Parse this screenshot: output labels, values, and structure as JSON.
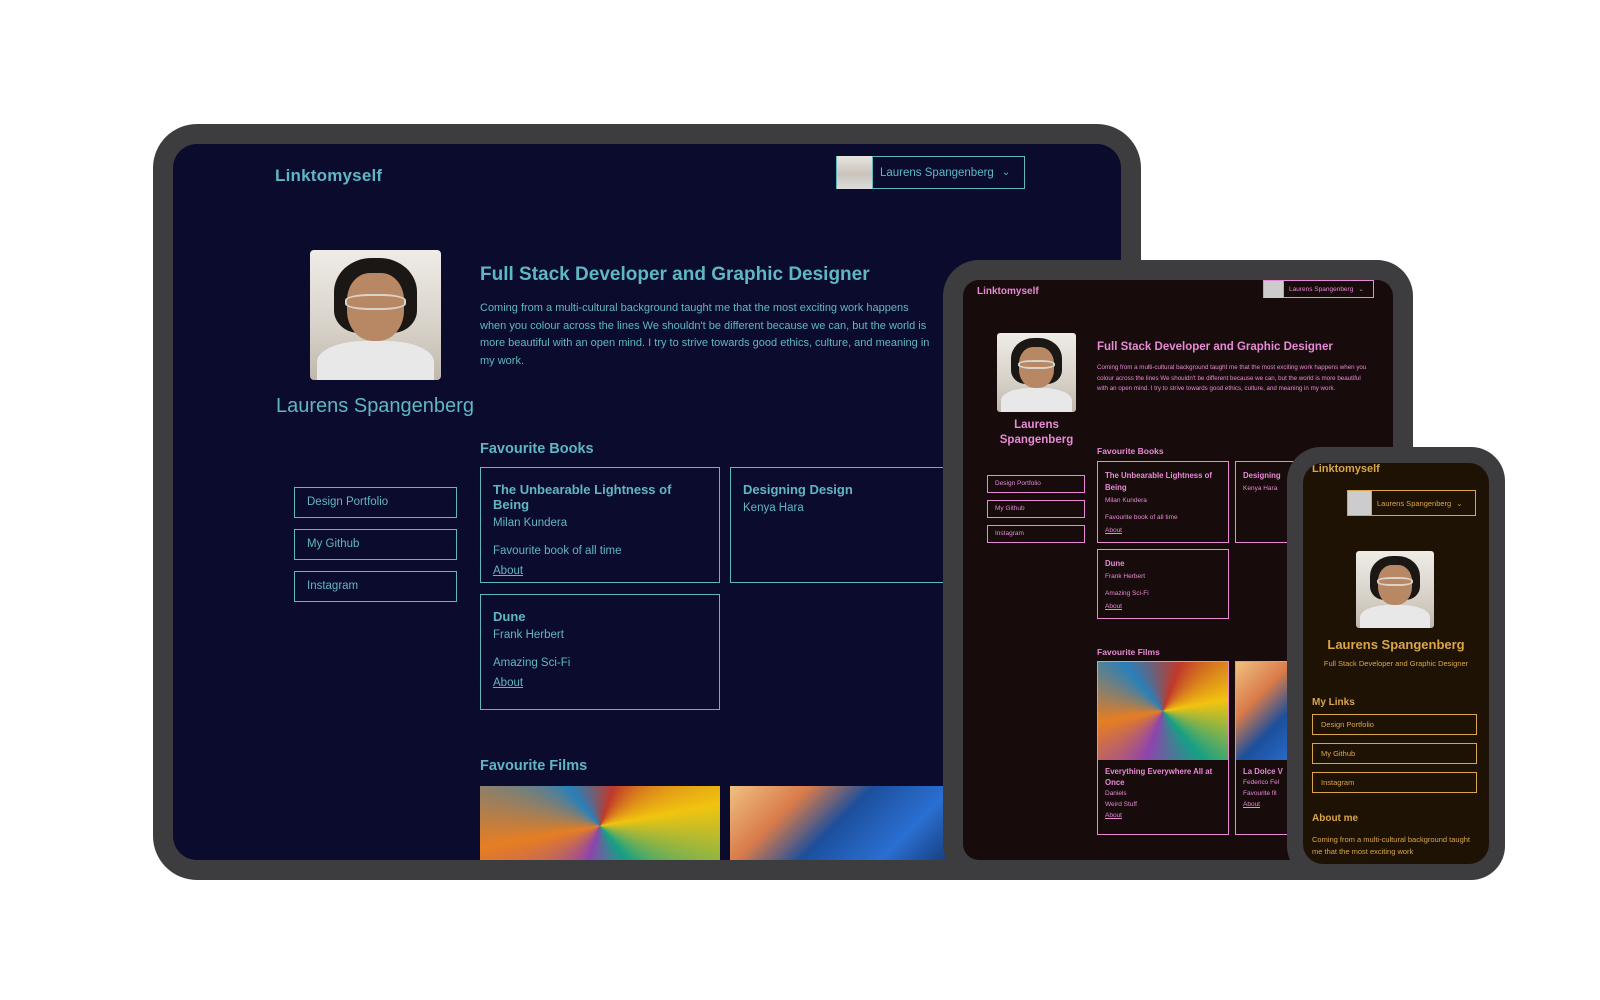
{
  "desktop": {
    "logo": "Linktomyself",
    "user_name": "Laurens Spangenberg",
    "profile_name": "Laurens Spangenberg",
    "links": [
      "Design Portfolio",
      "My Github",
      "Instagram"
    ],
    "headline": "Full Stack Developer and Graphic Designer",
    "bio": "Coming from a multi-cultural background taught me that the most exciting work happens when you colour across the lines We shouldn't be different because we can, but the world is more beautiful with an open mind. I try to strive towards good ethics, culture, and meaning in my work.",
    "books_heading": "Favourite Books",
    "books": [
      {
        "title": "The Unbearable Lightness of Being",
        "author": "Milan Kundera",
        "note": "Favourite book of all time",
        "link": "About"
      },
      {
        "title": "Designing Design",
        "author": "Kenya Hara",
        "note": "",
        "link": ""
      },
      {
        "title": "Dune",
        "author": "Frank Herbert",
        "note": "Amazing Sci-Fi",
        "link": "About"
      }
    ],
    "films_heading": "Favourite Films"
  },
  "tablet": {
    "logo": "Linktomyself",
    "user_name": "Laurens Spangenberg",
    "profile_name": "Laurens Spangenberg",
    "links": [
      "Design Portfolio",
      "My Github",
      "Instagram"
    ],
    "headline": "Full Stack Developer and Graphic Designer",
    "bio": "Coming from a multi-cultural background taught me that the most exciting work happens when you colour across the lines We shouldn't be different because we can, but the world is more beautiful with an open mind. I try to strive towards good ethics, culture, and meaning in my work.",
    "books_heading": "Favourite Books",
    "books": [
      {
        "title": "The Unbearable Lightness of Being",
        "author": "Milan Kundera",
        "note": "Favourite book of all time",
        "link": "About"
      },
      {
        "title": "Designing",
        "author": "Kenya Hara",
        "note": "",
        "link": ""
      },
      {
        "title": "Dune",
        "author": "Frank Herbert",
        "note": "Amazing Sci-Fi",
        "link": "About"
      }
    ],
    "films_heading": "Favourite Films",
    "films": [
      {
        "title": "Everything Everywhere All at Once",
        "director": "Daniels",
        "note": "Weird Stuff",
        "link": "About"
      },
      {
        "title": "La Dolce V",
        "director": "Federico Fel",
        "note": "Favourite fil",
        "link": "About"
      }
    ]
  },
  "phone": {
    "logo": "Linktomyself",
    "user_name": "Laurens Spangenberg",
    "profile_name": "Laurens Spangenberg",
    "subtitle": "Full Stack Developer and Graphic Designer",
    "links_heading": "My Links",
    "links": [
      "Design Portfolio",
      "My Github",
      "Instagram"
    ],
    "about_heading": "About me",
    "bio": "Coming from a multi-cultural background taught me that the most exciting work"
  },
  "icons": {
    "dropdown": "chevron-down-icon"
  },
  "colors": {
    "desktop_bg": "#0b0b2e",
    "desktop_accent": "#5fb7c2",
    "tablet_bg": "#170b0c",
    "tablet_accent": "#e88ad6",
    "phone_bg": "#1e1204",
    "phone_accent": "#d9a64a"
  }
}
